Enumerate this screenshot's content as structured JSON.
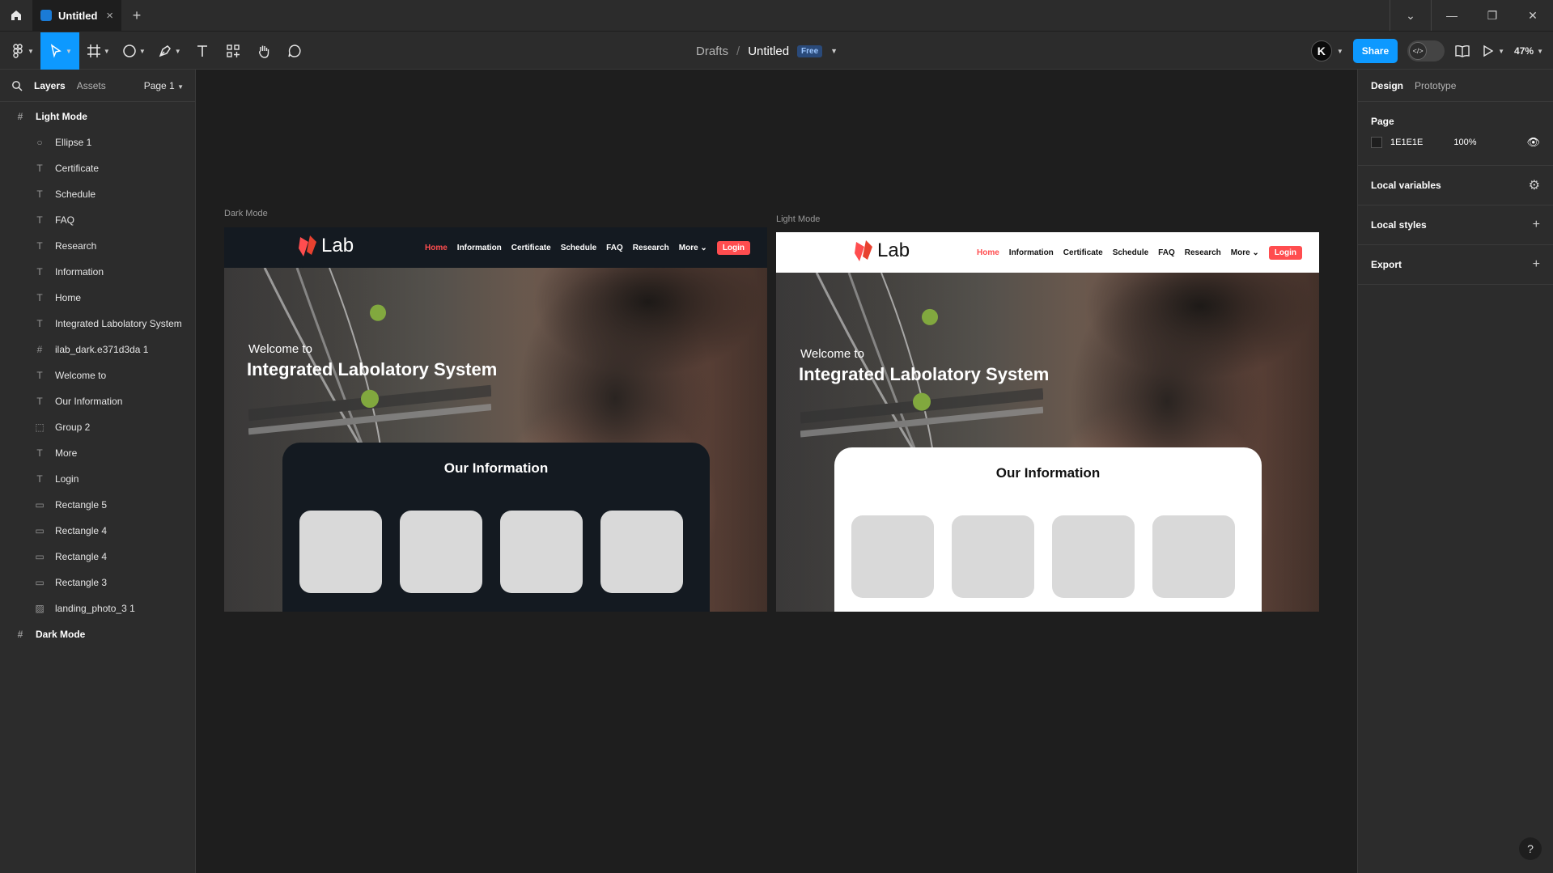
{
  "titlebar": {
    "tab_title": "Untitled",
    "tab_close": "×",
    "new_tab": "+",
    "window_controls": {
      "dropdown": "⌄",
      "minimize": "—",
      "restore": "❐",
      "close": "✕"
    }
  },
  "toolbar": {
    "breadcrumb_drafts": "Drafts",
    "breadcrumb_sep": "/",
    "file_title": "Untitled",
    "plan_badge": "Free",
    "avatar_letter": "K",
    "share_label": "Share",
    "zoom": "47%"
  },
  "left_panel": {
    "tab_layers": "Layers",
    "tab_assets": "Assets",
    "page_select": "Page 1",
    "layers": [
      {
        "label": "Light Mode",
        "icon": "frame-icon",
        "level": "top"
      },
      {
        "label": "Ellipse 1",
        "icon": "ellipse-icon",
        "level": "child"
      },
      {
        "label": "Certificate",
        "icon": "text-icon",
        "level": "child"
      },
      {
        "label": "Schedule",
        "icon": "text-icon",
        "level": "child"
      },
      {
        "label": "FAQ",
        "icon": "text-icon",
        "level": "child"
      },
      {
        "label": "Research",
        "icon": "text-icon",
        "level": "child"
      },
      {
        "label": "Information",
        "icon": "text-icon",
        "level": "child"
      },
      {
        "label": "Home",
        "icon": "text-icon",
        "level": "child"
      },
      {
        "label": "Integrated Labolatory System",
        "icon": "text-icon",
        "level": "child"
      },
      {
        "label": "ilab_dark.e371d3da 1",
        "icon": "frame-icon",
        "level": "child"
      },
      {
        "label": "Welcome to",
        "icon": "text-icon",
        "level": "child"
      },
      {
        "label": "Our Information",
        "icon": "text-icon",
        "level": "child"
      },
      {
        "label": "Group 2",
        "icon": "group-icon",
        "level": "child"
      },
      {
        "label": "More",
        "icon": "text-icon",
        "level": "child"
      },
      {
        "label": "Login",
        "icon": "text-icon",
        "level": "child"
      },
      {
        "label": "Rectangle 5",
        "icon": "rectangle-icon",
        "level": "child"
      },
      {
        "label": "Rectangle 4",
        "icon": "rectangle-icon",
        "level": "child"
      },
      {
        "label": "Rectangle 4",
        "icon": "rectangle-icon",
        "level": "child"
      },
      {
        "label": "Rectangle 3",
        "icon": "rectangle-icon",
        "level": "child"
      },
      {
        "label": "landing_photo_3 1",
        "icon": "image-icon",
        "level": "child"
      },
      {
        "label": "Dark Mode",
        "icon": "frame-icon",
        "level": "top"
      }
    ]
  },
  "right_panel": {
    "tab_design": "Design",
    "tab_prototype": "Prototype",
    "page_heading": "Page",
    "page_color": "1E1E1E",
    "page_opacity": "100%",
    "local_variables": "Local variables",
    "local_styles": "Local styles",
    "export": "Export",
    "help": "?"
  },
  "canvas": {
    "dark_frame_label": "Dark Mode",
    "light_frame_label": "Light Mode",
    "site": {
      "logo_text": "Lab",
      "nav": [
        "Home",
        "Information",
        "Certificate",
        "Schedule",
        "FAQ",
        "Research",
        "More"
      ],
      "login": "Login",
      "welcome": "Welcome to",
      "headline": "Integrated Labolatory System",
      "info_title": "Our Information"
    }
  },
  "colors": {
    "accent": "#0d99ff",
    "brand_red": "#ff4d4f",
    "dark_nav": "#141a21",
    "canvas_bg": "#1e1e1e",
    "panel_bg": "#2c2c2c"
  }
}
